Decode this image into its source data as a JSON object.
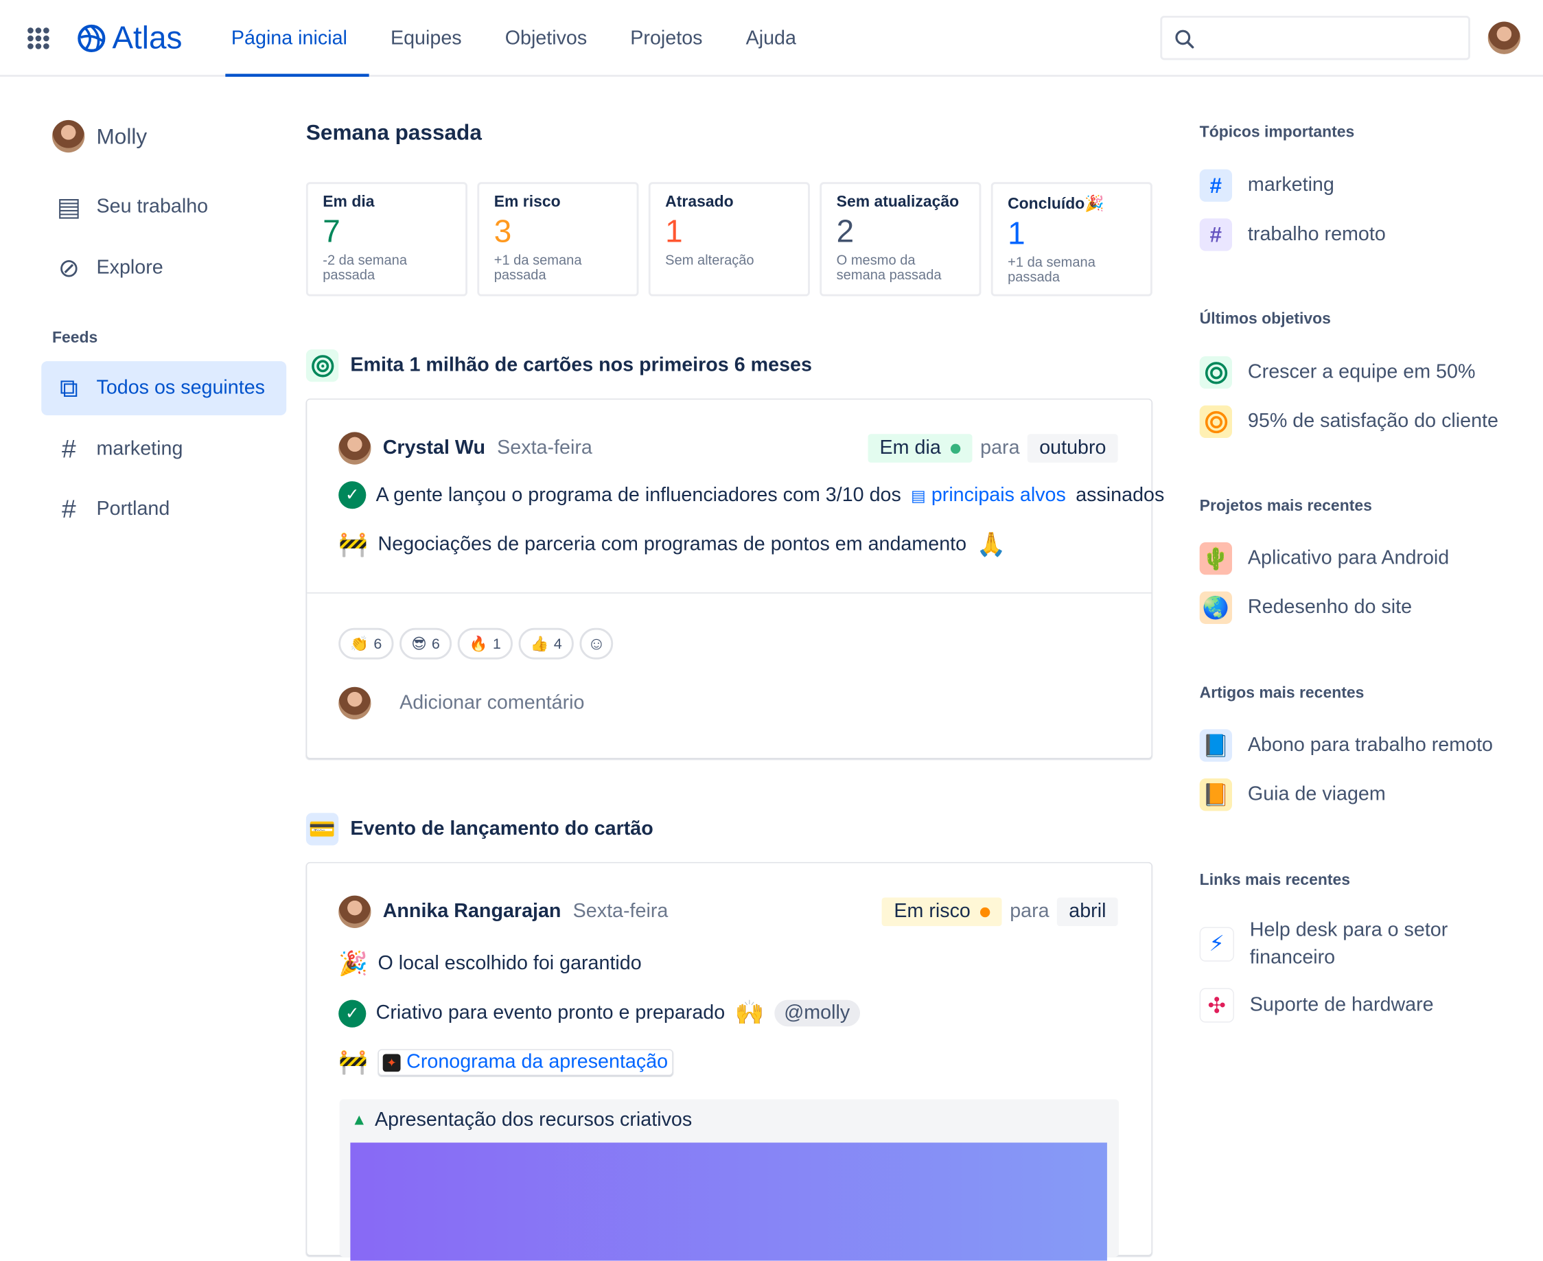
{
  "header": {
    "logo": "Atlas",
    "nav": [
      "Página inicial",
      "Equipes",
      "Objetivos",
      "Projetos",
      "Ajuda"
    ],
    "active_nav": "Página inicial",
    "search_placeholder": ""
  },
  "sidebar": {
    "user": "Molly",
    "items": [
      "Seu trabalho",
      "Explore"
    ],
    "feeds_label": "Feeds",
    "feeds": [
      "Todos os seguintes",
      "marketing",
      "Portland"
    ]
  },
  "main": {
    "title": "Semana passada",
    "cards": [
      {
        "label": "Em dia",
        "value": "7",
        "sub": "-2 da semana passada",
        "color": "#00875A"
      },
      {
        "label": "Em risco",
        "value": "3",
        "sub": "+1 da semana passada",
        "color": "#FF991F"
      },
      {
        "label": "Atrasado",
        "value": "1",
        "sub": "Sem alteração",
        "color": "#FF5630"
      },
      {
        "label": "Sem atualização",
        "value": "2",
        "sub": "O mesmo da semana passada",
        "color": "#42526E"
      },
      {
        "label": "Concluído",
        "value": "1",
        "sub": "+1 da semana passada",
        "color": "#0065FF",
        "emoji": "🎉"
      }
    ],
    "post1": {
      "goal": "Emita 1 milhão de cartões nos primeiros 6 meses",
      "author": "Crystal Wu",
      "date": "Sexta-feira",
      "status": "Em dia",
      "status_color": "#36B37E",
      "para": "para",
      "target": "outubro",
      "line1_pre": "A gente lançou o programa de influenciadores com 3/10 dos",
      "line1_link": "principais alvos",
      "line1_post": "assinados",
      "line2": "Negociações de parceria com programas de pontos em andamento",
      "reactions": [
        {
          "emoji": "👏",
          "count": "6"
        },
        {
          "emoji": "😎",
          "count": "6"
        },
        {
          "emoji": "🔥",
          "count": "1"
        },
        {
          "emoji": "👍",
          "count": "4"
        }
      ],
      "comment_placeholder": "Adicionar comentário"
    },
    "post2": {
      "goal": "Evento de lançamento do cartão",
      "author": "Annika Rangarajan",
      "date": "Sexta-feira",
      "status": "Em risco",
      "status_color": "#FF8B00",
      "para": "para",
      "target": "abril",
      "line1": "O local escolhido foi garantido",
      "line2": "Criativo para evento pronto e preparado",
      "mention": "@molly",
      "line3_link": "Cronograma da apresentação",
      "attachment": "Apresentação dos recursos criativos"
    }
  },
  "right": {
    "topics_label": "Tópicos importantes",
    "topics": [
      "marketing",
      "trabalho remoto"
    ],
    "goals_label": "Últimos objetivos",
    "goals": [
      "Crescer a equipe em 50%",
      "95% de satisfação do cliente"
    ],
    "projects_label": "Projetos mais recentes",
    "projects": [
      "Aplicativo para Android",
      "Redesenho do site"
    ],
    "articles_label": "Artigos mais recentes",
    "articles": [
      "Abono para trabalho remoto",
      "Guia de viagem"
    ],
    "links_label": "Links mais recentes",
    "links": [
      "Help desk para o setor financeiro",
      "Suporte de hardware"
    ]
  }
}
